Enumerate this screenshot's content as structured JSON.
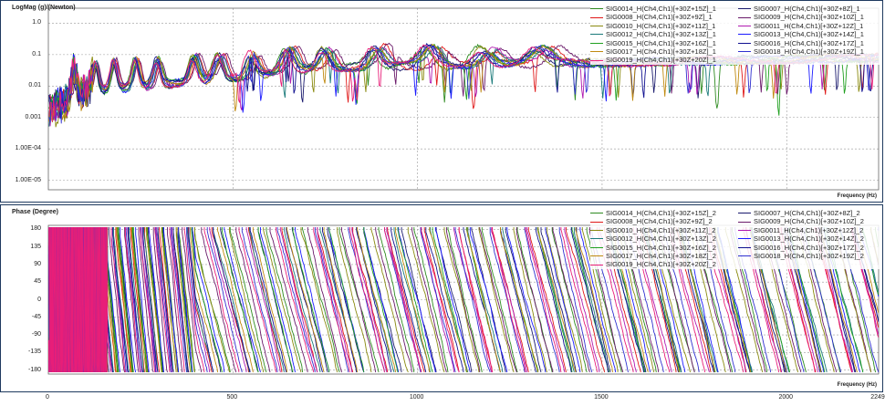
{
  "chart_data": [
    {
      "type": "line",
      "ylabel": "LogMag (g)/(Newton)",
      "xlabel": "Frequency (Hz)",
      "yscale": "log",
      "ylim": [
        5e-06,
        3
      ],
      "xlim": [
        0,
        2249
      ],
      "yticks": [
        "1.0",
        "0.1",
        "0.01",
        "0.001",
        "1.00E-04",
        "1.00E-05"
      ],
      "ytick_values": [
        1,
        0.1,
        0.01,
        0.001,
        0.0001,
        1e-05
      ],
      "grid": true,
      "legend_position": "top-right",
      "series": [
        {
          "name": "SIG0014_H(Ch4,Ch1)[+30Z+15Z]_1",
          "color": "#2e8b20"
        },
        {
          "name": "SIG0007_H(Ch4,Ch1)[+30Z+8Z]_1",
          "color": "#1a1a6e"
        },
        {
          "name": "SIG0008_H(Ch4,Ch1)[+30Z+9Z]_1",
          "color": "#e01818"
        },
        {
          "name": "SIG0009_H(Ch4,Ch1)[+30Z+10Z]_1",
          "color": "#6a1a6a"
        },
        {
          "name": "SIG0010_H(Ch4,Ch1)[+30Z+11Z]_1",
          "color": "#8a8a10"
        },
        {
          "name": "SIG0011_H(Ch4,Ch1)[+30Z+12Z]_1",
          "color": "#b01ab0"
        },
        {
          "name": "SIG0012_H(Ch4,Ch1)[+30Z+13Z]_1",
          "color": "#1a7a7a"
        },
        {
          "name": "SIG0013_H(Ch4,Ch1)[+30Z+14Z]_1",
          "color": "#1a1aff"
        },
        {
          "name": "SIG0015_H(Ch4,Ch1)[+30Z+16Z]_1",
          "color": "#20a020"
        },
        {
          "name": "SIG0016_H(Ch4,Ch1)[+30Z+17Z]_1",
          "color": "#101090"
        },
        {
          "name": "SIG0017_H(Ch4,Ch1)[+30Z+18Z]_1",
          "color": "#c08a10"
        },
        {
          "name": "SIG0018_H(Ch4,Ch1)[+30Z+19Z]_1",
          "color": "#3030d0"
        },
        {
          "name": "SIG0019_H(Ch4,Ch1)[+30Z+20Z]_1",
          "color": "#e81e78"
        }
      ]
    },
    {
      "type": "line",
      "ylabel": "Phase (Degree)",
      "xlabel": "Frequency (Hz)",
      "ylim": [
        -190,
        190
      ],
      "xlim": [
        0,
        2249
      ],
      "yticks": [
        "180",
        "135",
        "90",
        "45",
        "0",
        "-45",
        "-90",
        "-135",
        "-180"
      ],
      "ytick_values": [
        180,
        135,
        90,
        45,
        0,
        -45,
        -90,
        -135,
        -180
      ],
      "xticks": [
        "0",
        "500",
        "1000",
        "1500",
        "2000",
        "2249"
      ],
      "xtick_values": [
        0,
        500,
        1000,
        1500,
        2000,
        2249
      ],
      "grid": true,
      "legend_position": "top-right",
      "series": [
        {
          "name": "SIG0014_H(Ch4,Ch1)[+30Z+15Z]_2",
          "color": "#2e8b20"
        },
        {
          "name": "SIG0007_H(Ch4,Ch1)[+30Z+8Z]_2",
          "color": "#1a1a6e"
        },
        {
          "name": "SIG0008_H(Ch4,Ch1)[+30Z+9Z]_2",
          "color": "#e01818"
        },
        {
          "name": "SIG0009_H(Ch4,Ch1)[+30Z+10Z]_2",
          "color": "#6a1a6a"
        },
        {
          "name": "SIG0010_H(Ch4,Ch1)[+30Z+11Z]_2",
          "color": "#8a8a10"
        },
        {
          "name": "SIG0011_H(Ch4,Ch1)[+30Z+12Z]_2",
          "color": "#b01ab0"
        },
        {
          "name": "SIG0012_H(Ch4,Ch1)[+30Z+13Z]_2",
          "color": "#1a7a7a"
        },
        {
          "name": "SIG0013_H(Ch4,Ch1)[+30Z+14Z]_2",
          "color": "#1a1aff"
        },
        {
          "name": "SIG0015_H(Ch4,Ch1)[+30Z+16Z]_2",
          "color": "#20a020"
        },
        {
          "name": "SIG0016_H(Ch4,Ch1)[+30Z+17Z]_2",
          "color": "#101090"
        },
        {
          "name": "SIG0017_H(Ch4,Ch1)[+30Z+18Z]_2",
          "color": "#c08a10"
        },
        {
          "name": "SIG0018_H(Ch4,Ch1)[+30Z+19Z]_2",
          "color": "#3030d0"
        },
        {
          "name": "SIG0019_H(Ch4,Ch1)[+30Z+20Z]_2",
          "color": "#e81e78"
        }
      ]
    }
  ]
}
